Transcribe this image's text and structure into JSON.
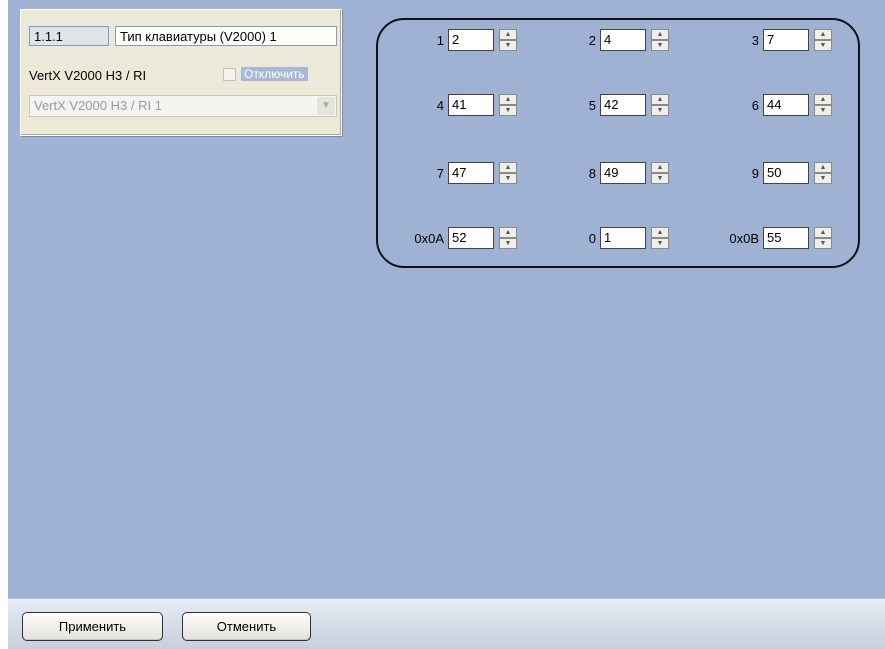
{
  "device_group": {
    "id": "1.1.1",
    "name": "Тип клавиатуры (V2000) 1",
    "model_label": "VertX V2000 H3 / RI",
    "disable_label": "Отключить",
    "disable_checked": false,
    "selected_device": "VertX V2000 H3 / RI 1"
  },
  "keys": [
    {
      "label": "1",
      "value": "2"
    },
    {
      "label": "2",
      "value": "4"
    },
    {
      "label": "3",
      "value": "7"
    },
    {
      "label": "4",
      "value": "41"
    },
    {
      "label": "5",
      "value": "42"
    },
    {
      "label": "6",
      "value": "44"
    },
    {
      "label": "7",
      "value": "47"
    },
    {
      "label": "8",
      "value": "49"
    },
    {
      "label": "9",
      "value": "50"
    },
    {
      "label": "0x0A",
      "value": "52"
    },
    {
      "label": "0",
      "value": "1"
    },
    {
      "label": "0x0B",
      "value": "55"
    }
  ],
  "buttons": {
    "apply": "Применить",
    "cancel": "Отменить"
  },
  "colors": {
    "panel_background": "#a0b2d4",
    "group_background": "#ece9d8"
  },
  "icons": {
    "spin_up": "arrow-up-icon",
    "spin_down": "arrow-down-icon",
    "combo_arrow": "chevron-down-icon"
  }
}
